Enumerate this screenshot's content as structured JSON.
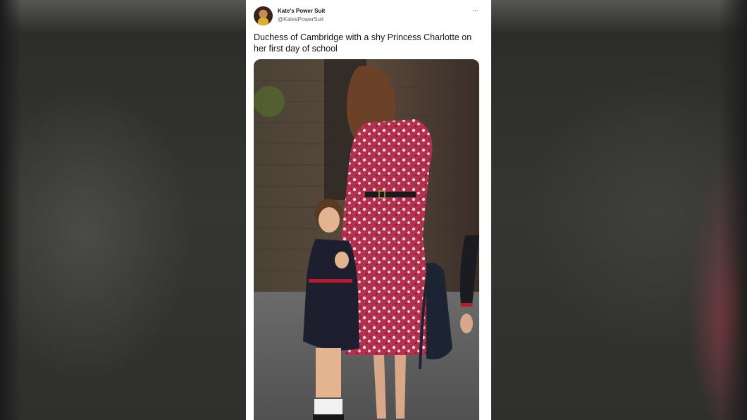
{
  "tweet": {
    "author_name": "Kate's Power Suit",
    "author_handle": "@KatesPowerSuit",
    "more_icon": "more-horizontal-icon",
    "more_glyph": "···",
    "text": "Duchess of Cambridge with a shy Princess Charlotte on her first day of school"
  },
  "colors": {
    "card_background": "#ffffff",
    "name_color": "#0f1419",
    "secondary_text": "#536471",
    "dress_color": "#c23a57"
  }
}
